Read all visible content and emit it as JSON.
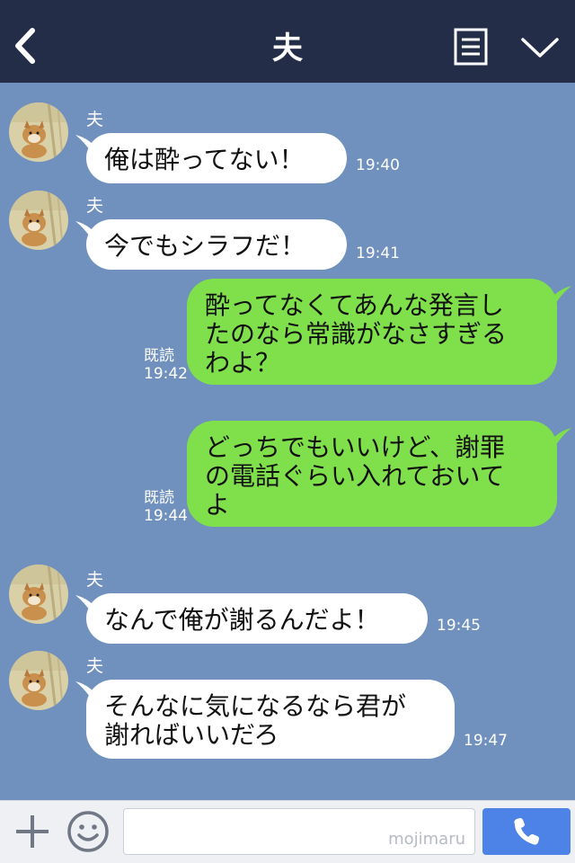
{
  "header": {
    "title": "夫",
    "back_icon": "chevron-left-icon",
    "menu_icon": "memo-icon",
    "collapse_icon": "chevron-down-icon"
  },
  "colors": {
    "header_bg": "#232d47",
    "chat_bg": "#7090be",
    "incoming_bubble": "#ffffff",
    "outgoing_bubble": "#80e04b",
    "send_button": "#4d83e6"
  },
  "messages": [
    {
      "direction": "in",
      "sender": "夫",
      "lines": [
        "俺は酔ってない！"
      ],
      "time": "19:40"
    },
    {
      "direction": "in",
      "sender": "夫",
      "lines": [
        "今でもシラフだ！"
      ],
      "time": "19:41"
    },
    {
      "direction": "out",
      "read": "既読",
      "lines": [
        "酔ってなくてあんな発言し",
        "たのなら常識がなさすぎる",
        "わよ？"
      ],
      "time": "19:42"
    },
    {
      "direction": "out",
      "read": "既読",
      "lines": [
        "どっちでもいいけど、謝罪",
        "の電話ぐらい入れておいて",
        "よ"
      ],
      "time": "19:44"
    },
    {
      "direction": "in",
      "sender": "夫",
      "lines": [
        "なんで俺が謝るんだよ！"
      ],
      "time": "19:45"
    },
    {
      "direction": "in",
      "sender": "夫",
      "lines": [
        "そんなに気になるなら君が",
        "謝ればいいだろ"
      ],
      "time": "19:47"
    }
  ],
  "input": {
    "placeholder": "",
    "watermark": "mojimaru"
  },
  "bottom_bar": {
    "plus_icon": "plus-icon",
    "emoji_icon": "smiley-icon",
    "call_icon": "phone-icon"
  }
}
